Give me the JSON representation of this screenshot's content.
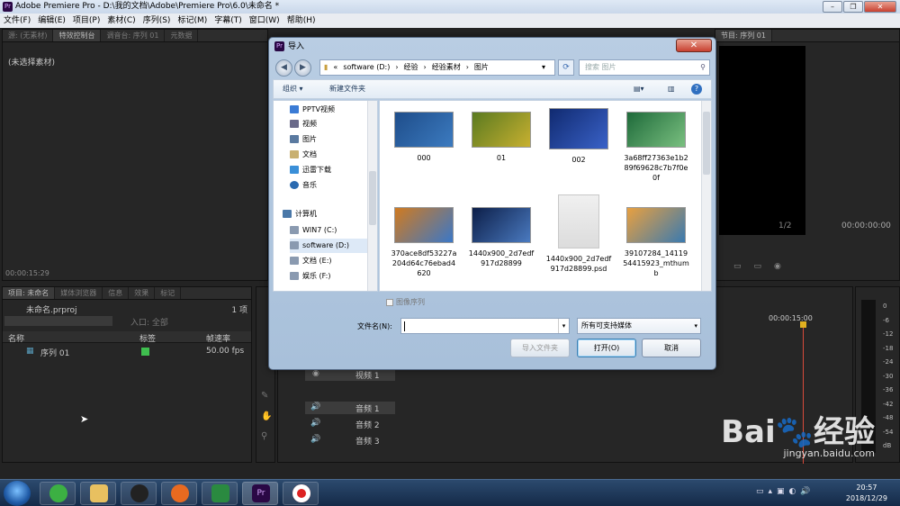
{
  "window": {
    "title": "Adobe Premiere Pro - D:\\我的文档\\Adobe\\Premiere Pro\\6.0\\未命名 *",
    "app_badge": "Pr"
  },
  "menu": [
    "文件(F)",
    "编辑(E)",
    "项目(P)",
    "素材(C)",
    "序列(S)",
    "标记(M)",
    "字幕(T)",
    "窗口(W)",
    "帮助(H)"
  ],
  "source_panel": {
    "tabs": [
      "源: (无素材)",
      "特效控制台",
      "调音台: 序列 01",
      "元数据"
    ],
    "empty_text": "(未选择素材)",
    "timecode": "00:00:15:29"
  },
  "program_panel": {
    "tab": "节目: 序列 01",
    "timecode": "00:00:00:00",
    "zoom": "1/2"
  },
  "project_panel": {
    "tabs": [
      "项目: 未命名",
      "媒体浏览器",
      "信息",
      "效果",
      "标记"
    ],
    "file": "未命名.prproj",
    "count": "1 项",
    "entry_label": "入口: 全部",
    "columns": [
      "名称",
      "标签",
      "帧速率"
    ],
    "rows": [
      {
        "name": "序列 01",
        "fps": "50.00 fps",
        "label_color": "#3fbf4f"
      }
    ]
  },
  "timeline": {
    "time": "00:00:15:00",
    "tracks": [
      "视频 1",
      "音频 1",
      "音频 2",
      "音频 3"
    ],
    "meter_labels": [
      "0",
      "-6",
      "-12",
      "-18",
      "-24",
      "-30",
      "-36",
      "-42",
      "-48",
      "-54",
      "dB"
    ]
  },
  "dialog": {
    "title": "导入",
    "address": [
      "«",
      "software (D:)",
      "›",
      "经验",
      "›",
      "经验素材",
      "›",
      "图片"
    ],
    "search_placeholder": "搜索 图片",
    "toolbar": {
      "organize": "组织 ▾",
      "new_folder": "新建文件夹"
    },
    "nav": [
      {
        "label": "PPTV视频",
        "color": "#3a7bd5"
      },
      {
        "label": "视频",
        "color": "#6a6a8a"
      },
      {
        "label": "图片",
        "color": "#5a7aa0"
      },
      {
        "label": "文档",
        "color": "#c8b070"
      },
      {
        "label": "迅雷下载",
        "color": "#3a8fd8"
      },
      {
        "label": "音乐",
        "color": "#2a6ab0"
      },
      {
        "label": "计算机",
        "color": "#4a78a8"
      },
      {
        "label": "WIN7 (C:)",
        "color": "#8a9ab0"
      },
      {
        "label": "software (D:)",
        "color": "#8a9ab0"
      },
      {
        "label": "文档 (E:)",
        "color": "#8a9ab0"
      },
      {
        "label": "娱乐 (F:)",
        "color": "#8a9ab0"
      }
    ],
    "files": [
      {
        "name": "000",
        "colors": [
          "#1e4d8a",
          "#3c7bc0"
        ]
      },
      {
        "name": "01",
        "colors": [
          "#5a7a20",
          "#c8b030"
        ]
      },
      {
        "name": "002",
        "colors": [
          "#102a70",
          "#3a62c8"
        ]
      },
      {
        "name": "3a68ff27363e1b289f69628c7b7f0e0f",
        "colors": [
          "#1e6a3a",
          "#7ac080"
        ]
      },
      {
        "name": "370ace8df53227a204d64c76ebad4620",
        "colors": [
          "#d07a20",
          "#3a78c8"
        ]
      },
      {
        "name": "1440x900_2d7edf917d28899",
        "colors": [
          "#0c1e48",
          "#4a7ac0"
        ]
      },
      {
        "name": "1440x900_2d7edf917d28899.psd",
        "colors": [
          "#f0f0f0",
          "#dcdcdc"
        ]
      },
      {
        "name": "39107284_1411954415923_mthumb",
        "colors": [
          "#e8a040",
          "#3a7ab0"
        ]
      }
    ],
    "sequence_checkbox": "图像序列",
    "filename_label": "文件名(N):",
    "filename_value": "",
    "filetype": "所有可支持媒体",
    "buttons": {
      "import_folder": "导入文件夹",
      "open": "打开(O)",
      "cancel": "取消"
    }
  },
  "taskbar": {
    "time": "20:57",
    "date": "2018/12/29"
  }
}
